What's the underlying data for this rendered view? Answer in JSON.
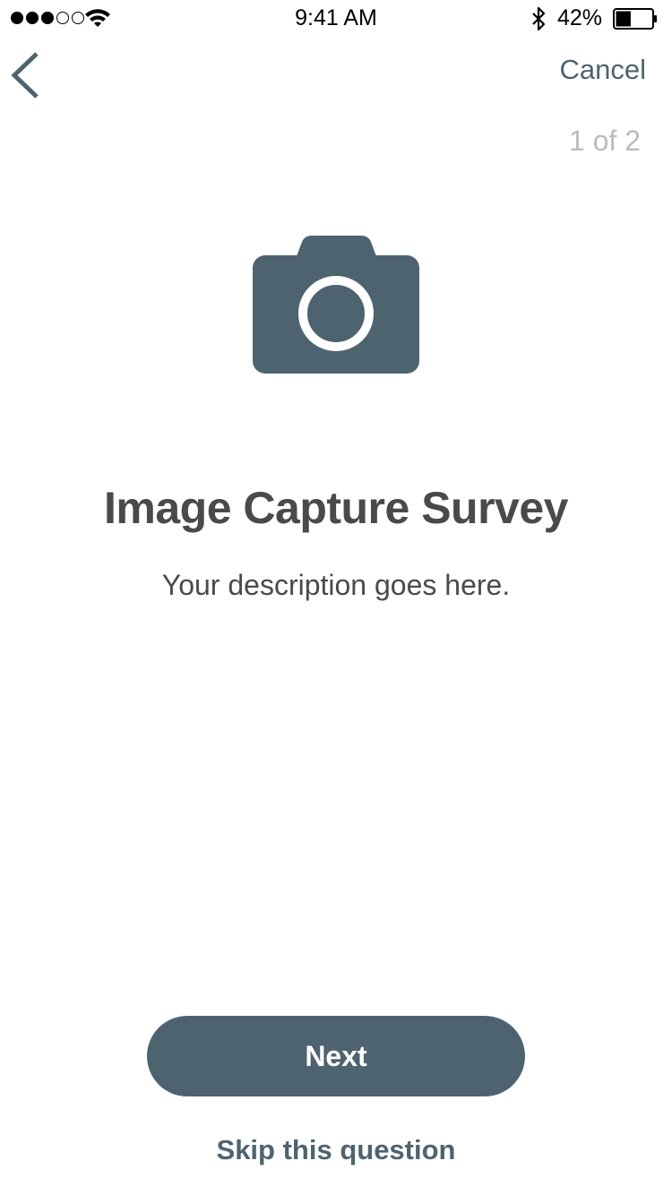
{
  "status_bar": {
    "time": "9:41 AM",
    "battery_percent": "42%",
    "signal_strength": 3,
    "signal_max": 5,
    "battery_level": 0.42,
    "icons": [
      "signal-dots-icon",
      "wifi-icon",
      "bluetooth-icon",
      "battery-icon"
    ]
  },
  "nav": {
    "back_icon": "chevron-left-icon",
    "cancel_label": "Cancel",
    "progress": "1 of 2"
  },
  "content": {
    "icon": "camera-icon",
    "title": "Image Capture Survey",
    "description": "Your description goes here."
  },
  "actions": {
    "next_label": "Next",
    "skip_label": "Skip this question"
  },
  "colors": {
    "accent": "#4e6370",
    "text": "#4a4a4a",
    "muted": "#b9bdc1",
    "background": "#ffffff"
  }
}
